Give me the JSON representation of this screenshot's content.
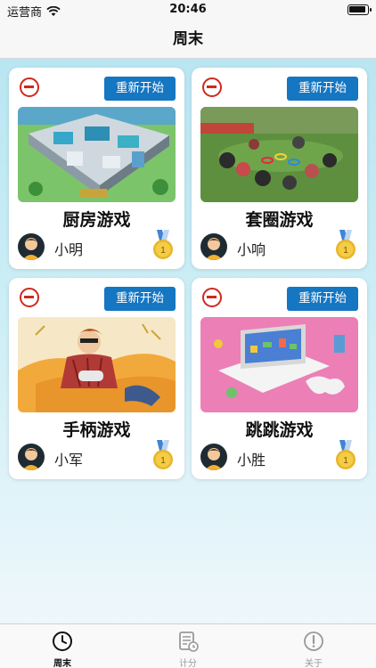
{
  "status_bar": {
    "carrier": "运营商",
    "time": "20:46",
    "battery_level": 0.9
  },
  "nav": {
    "title": "周末"
  },
  "cards": [
    {
      "restart_label": "重新开始",
      "title": "厨房游戏",
      "player": "小明",
      "medal_number": "1",
      "thumb": "kitchen-game-image"
    },
    {
      "restart_label": "重新开始",
      "title": "套圈游戏",
      "player": "小响",
      "medal_number": "1",
      "thumb": "ring-toss-game-image"
    },
    {
      "restart_label": "重新开始",
      "title": "手柄游戏",
      "player": "小军",
      "medal_number": "1",
      "thumb": "gamepad-game-image"
    },
    {
      "restart_label": "重新开始",
      "title": "跳跳游戏",
      "player": "小胜",
      "medal_number": "1",
      "thumb": "jump-game-image"
    }
  ],
  "tabs": [
    {
      "label": "周末",
      "icon": "clock-icon",
      "active": true
    },
    {
      "label": "计分",
      "icon": "scoresheet-icon",
      "active": false
    },
    {
      "label": "关于",
      "icon": "info-icon",
      "active": false
    }
  ],
  "colors": {
    "accent": "#1576c2",
    "remove": "#d0281e",
    "medal_gold": "#e8b52a",
    "medal_ribbon": "#3f84d6"
  }
}
